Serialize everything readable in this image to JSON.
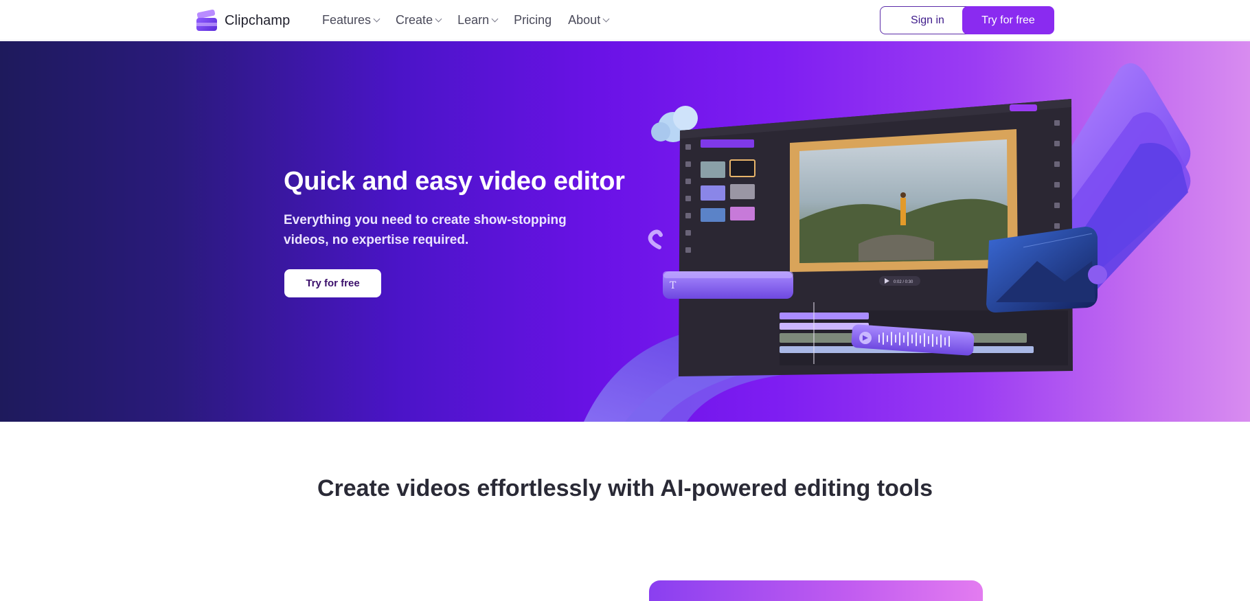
{
  "header": {
    "brand": "Clipchamp",
    "nav": [
      {
        "label": "Features",
        "has_menu": true
      },
      {
        "label": "Create",
        "has_menu": true
      },
      {
        "label": "Learn",
        "has_menu": true
      },
      {
        "label": "Pricing",
        "has_menu": false
      },
      {
        "label": "About",
        "has_menu": true
      }
    ],
    "sign_in": "Sign in",
    "try_free": "Try for free"
  },
  "hero": {
    "title": "Quick and easy video editor",
    "subtitle": "Everything you need to create show-stopping videos, no expertise required.",
    "cta": "Try for free",
    "editor_timecode": "0:02 / 0:30"
  },
  "section": {
    "title": "Create videos effortlessly with AI-powered editing tools"
  },
  "colors": {
    "accent": "#8a2bf0",
    "hero_start": "#1e1a5c",
    "hero_end": "#d88cf0",
    "text_dark": "#2a2a36"
  },
  "icons": [
    "clipchamp-logo-icon",
    "chevron-down-icon",
    "play-icon",
    "text-icon"
  ]
}
